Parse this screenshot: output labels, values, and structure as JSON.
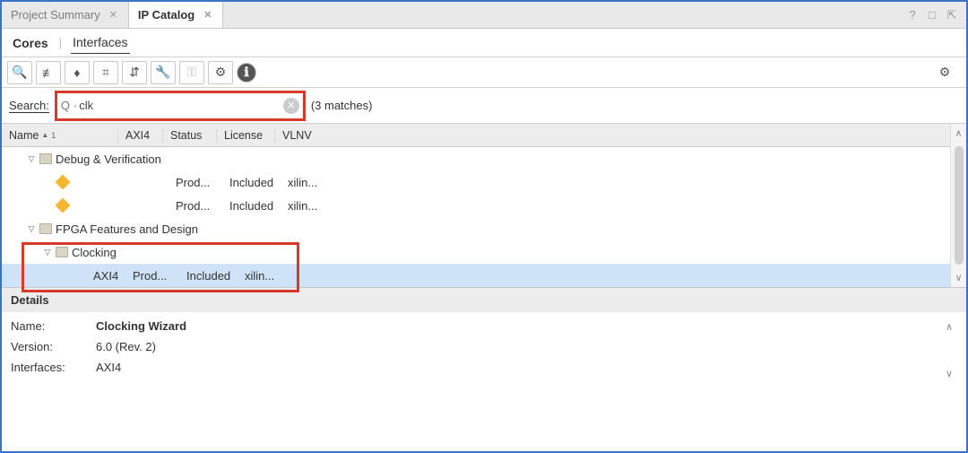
{
  "tabs": [
    {
      "label": "Project Summary",
      "active": false
    },
    {
      "label": "IP Catalog",
      "active": true
    }
  ],
  "window_controls": {
    "help": "?",
    "max": "□",
    "pop": "⇱"
  },
  "subtabs": {
    "cores": "Cores",
    "divider": "|",
    "interfaces": "Interfaces"
  },
  "toolbar": {
    "search": "🔍",
    "collapse": "≢",
    "expand": "♦",
    "hier": "⌗",
    "group": "⇵",
    "wrench": "🔧",
    "key": "⚿",
    "gear": "⚙",
    "info": "ℹ",
    "settings": "⚙"
  },
  "search": {
    "label": "Search:",
    "value": "clk",
    "matches": "(3 matches)"
  },
  "columns": {
    "name": "Name",
    "sort_num": "1",
    "axi4": "AXI4",
    "status": "Status",
    "license": "License",
    "vlnv": "VLNV"
  },
  "tree": {
    "cat1": "Debug & Verification",
    "cat2": "FPGA Features and Design",
    "cat3": "Clocking",
    "item_status": "Prod...",
    "item_license": "Included",
    "item_vlnv": "xilin...",
    "item_axi4": "AXI4"
  },
  "details": {
    "title": "Details",
    "name_label": "Name:",
    "name_value": "Clocking Wizard",
    "version_label": "Version:",
    "version_value": "6.0 (Rev. 2)",
    "interfaces_label": "Interfaces:",
    "interfaces_value": "AXI4"
  }
}
